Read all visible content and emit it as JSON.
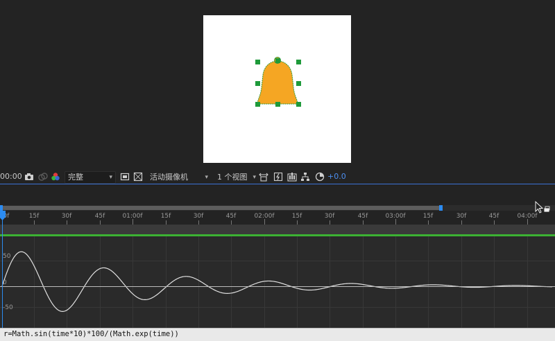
{
  "viewer": {
    "shape": {
      "name": "bell-shape",
      "fill": "#f5a623",
      "stroke": "#2f9a3a"
    }
  },
  "toolbar": {
    "timecode": "00:00",
    "resolution": "完整",
    "camera": "活动摄像机",
    "views": "1 个视图",
    "exposure": "+0.0",
    "icons": [
      "camera-icon",
      "color-channels-icon",
      "region-of-interest-icon",
      "transparency-grid-icon",
      "fast-preview-icon",
      "timeline-icon",
      "flowchart-icon",
      "reset-exposure-icon"
    ]
  },
  "timeline": {
    "ruler_labels": [
      "0f",
      "15f",
      "30f",
      "45f",
      "01:00f",
      "15f",
      "30f",
      "45f",
      "02:00f",
      "15f",
      "30f",
      "45f",
      "03:00f",
      "15f",
      "30f",
      "45f",
      "04:00f"
    ],
    "y_labels": [
      "50",
      "0",
      "-50"
    ],
    "colors": {
      "playhead": "#2c8cf2",
      "layer_bar": "#3cb233",
      "curve": "#e0e0e0"
    }
  },
  "graph_data": {
    "type": "line",
    "expression": "r=Math.sin(time*10)*100/(Math.exp(time))",
    "x_range_seconds": [
      0,
      4.2
    ],
    "y_unit_ticks": [
      50,
      0,
      -50
    ]
  },
  "expression_bar": {
    "text": "r=Math.sin(time*10)*100/(Math.exp(time))"
  }
}
